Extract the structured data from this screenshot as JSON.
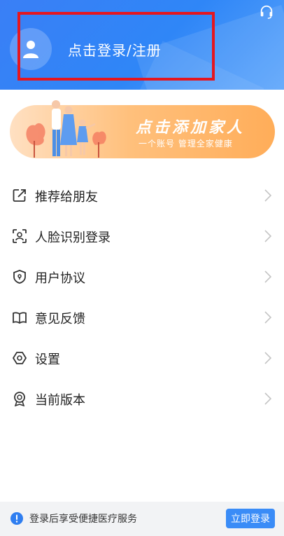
{
  "header": {
    "login_prompt": "点击登录/注册",
    "colors": {
      "primary_blue": "#3a7ff6",
      "highlight_box": "#e5161f"
    }
  },
  "family_banner": {
    "title": "点击添加家人",
    "subtitle": "一个账号 管理全家健康"
  },
  "menu": {
    "items": [
      {
        "label": "推荐给朋友",
        "icon": "share-icon"
      },
      {
        "label": "人脸识别登录",
        "icon": "face-scan-icon"
      },
      {
        "label": "用户协议",
        "icon": "shield-icon"
      },
      {
        "label": "意见反馈",
        "icon": "book-icon"
      },
      {
        "label": "设置",
        "icon": "settings-icon"
      },
      {
        "label": "当前版本",
        "icon": "badge-icon"
      }
    ]
  },
  "footer": {
    "message": "登录后享受便捷医疗服务",
    "button_label": "立即登录"
  }
}
